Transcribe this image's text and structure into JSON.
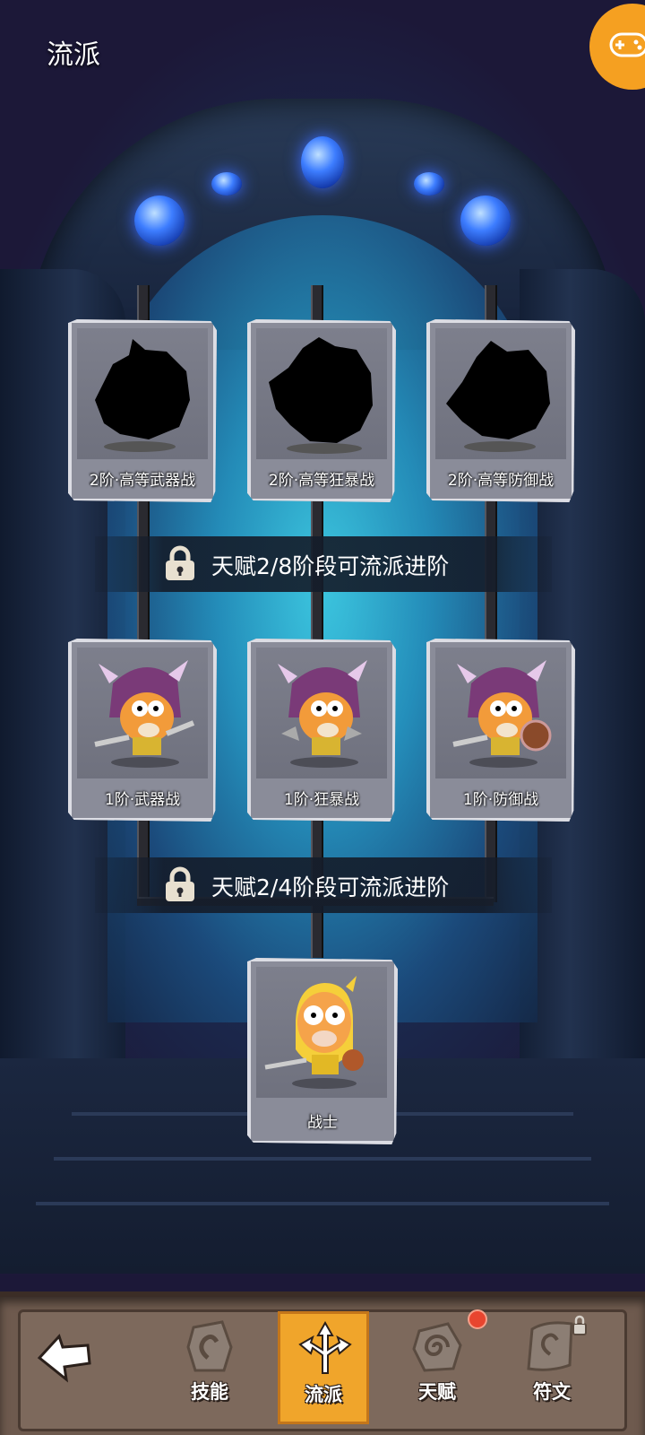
{
  "header": {
    "title": "流派"
  },
  "tiers": [
    {
      "cards": [
        {
          "label": "2阶·高等武器战",
          "locked": true
        },
        {
          "label": "2阶·高等狂暴战",
          "locked": true
        },
        {
          "label": "2阶·高等防御战",
          "locked": true
        }
      ]
    },
    {
      "cards": [
        {
          "label": "1阶·武器战",
          "locked": false
        },
        {
          "label": "1阶·狂暴战",
          "locked": false
        },
        {
          "label": "1阶·防御战",
          "locked": false
        }
      ]
    }
  ],
  "locks": {
    "tier2": "天赋2/8阶段可流派进阶",
    "tier1": "天赋2/4阶段可流派进阶"
  },
  "base_class": {
    "label": "战士"
  },
  "bottom_nav": {
    "items": [
      {
        "label": "技能",
        "icon": "skill-icon",
        "active": false
      },
      {
        "label": "流派",
        "icon": "school-icon",
        "active": true
      },
      {
        "label": "天赋",
        "icon": "talent-icon",
        "active": false,
        "badge": true
      },
      {
        "label": "符文",
        "icon": "rune-icon",
        "active": false,
        "locked": true
      }
    ]
  },
  "colors": {
    "accent": "#f5a021",
    "active_tab": "#f0a52b",
    "badge": "#e8452f"
  }
}
